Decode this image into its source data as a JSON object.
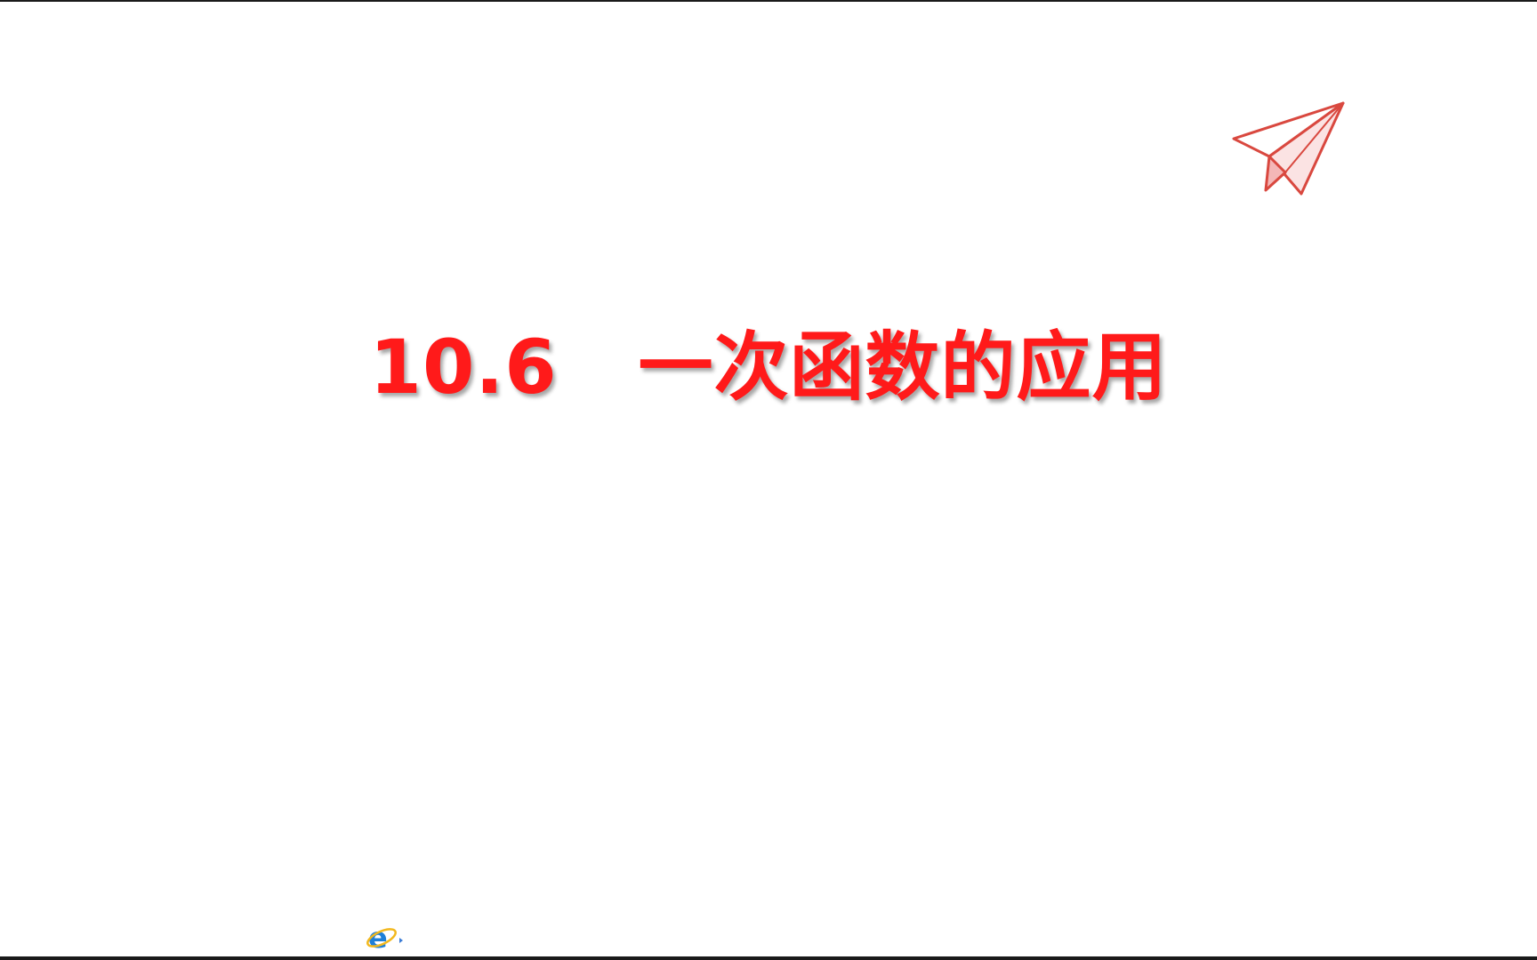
{
  "slide": {
    "title": "10.6   一次函数的应用",
    "title_color": "#ff1a1a"
  },
  "decorations": {
    "plane_icon": "paper-plane-icon",
    "plane_stroke": "#e05a5a",
    "plane_fill": "#f8d9d9"
  },
  "taskbar": {
    "browser_icon": "internet-explorer-icon",
    "browser_color": "#1e7fd8"
  }
}
